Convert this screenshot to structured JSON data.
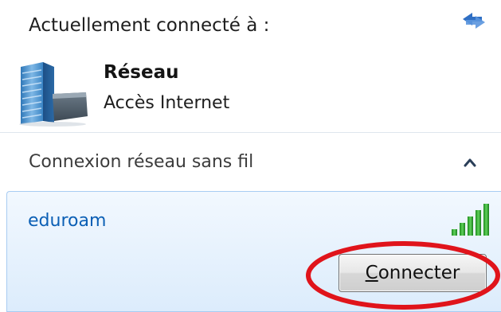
{
  "current": {
    "label": "Actuellement connecté à :",
    "network_name": "Réseau",
    "network_access": "Accès Internet",
    "network_icon": "network-building-icon",
    "refresh_icon": "refresh-icon"
  },
  "wireless": {
    "section_label": "Connexion réseau sans fil",
    "collapse_icon": "chevron-up-icon",
    "networks": [
      {
        "name": "eduroam",
        "signal_icon": "wifi-signal-icon",
        "signal_level": 1.0,
        "button": {
          "mnemonic": "C",
          "rest": "onnecter"
        }
      }
    ]
  },
  "annotation": {
    "color": "#e0141b"
  }
}
